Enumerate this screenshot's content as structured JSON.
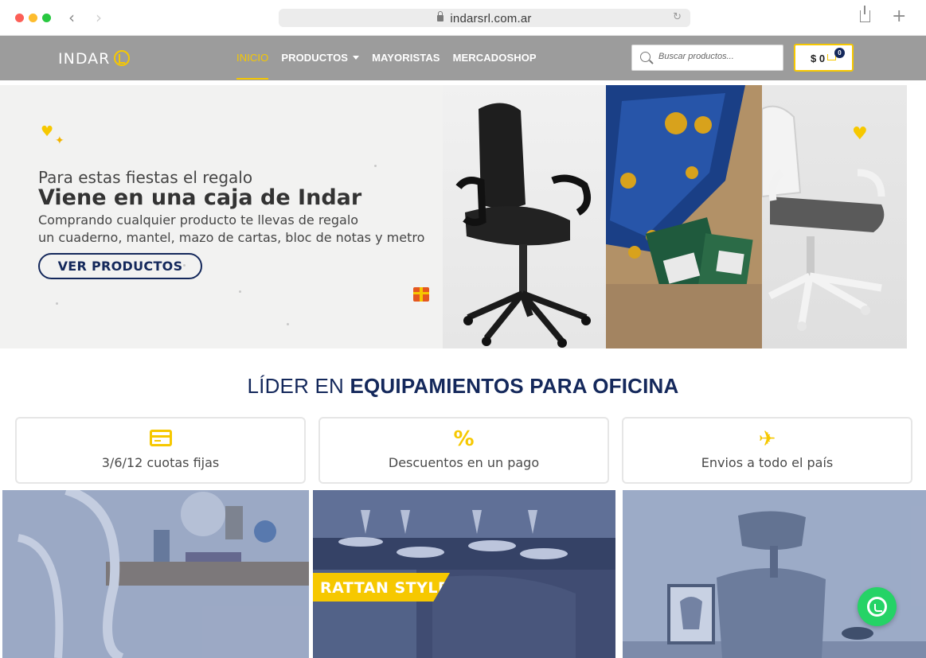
{
  "browser": {
    "url": "indarsrl.com.ar"
  },
  "header": {
    "logo_text": "INDAR",
    "nav": [
      {
        "label": "INICIO"
      },
      {
        "label": "PRODUCTOS"
      },
      {
        "label": "MAYORISTAS"
      },
      {
        "label": "MERCADOSHOP"
      }
    ],
    "search_placeholder": "Buscar productos...",
    "cart_total": "$ 0",
    "cart_count": "0"
  },
  "hero": {
    "line1": "Para estas fiestas el regalo",
    "line2": "Viene en una caja de Indar",
    "line3": "Comprando cualquier producto te llevas de regalo",
    "line4": "un cuaderno, mantel, mazo de cartas, bloc de notas y metro",
    "cta_label": "VER PRODUCTOS"
  },
  "section": {
    "title_light": "LÍDER EN ",
    "title_bold": "EQUIPAMIENTOS PARA OFICINA"
  },
  "features": [
    {
      "icon": "credit-card-icon",
      "label": "3/6/12 cuotas fijas"
    },
    {
      "icon": "percent-icon",
      "label": "Descuentos en un pago"
    },
    {
      "icon": "plane-icon",
      "label": "Envios a todo el país"
    }
  ],
  "categories": {
    "rattan_label": "RATTAN STYLE"
  },
  "colors": {
    "accent": "#f6c800",
    "navy": "#14285b",
    "header_gray": "#9c9c9c",
    "whatsapp": "#25d366"
  }
}
